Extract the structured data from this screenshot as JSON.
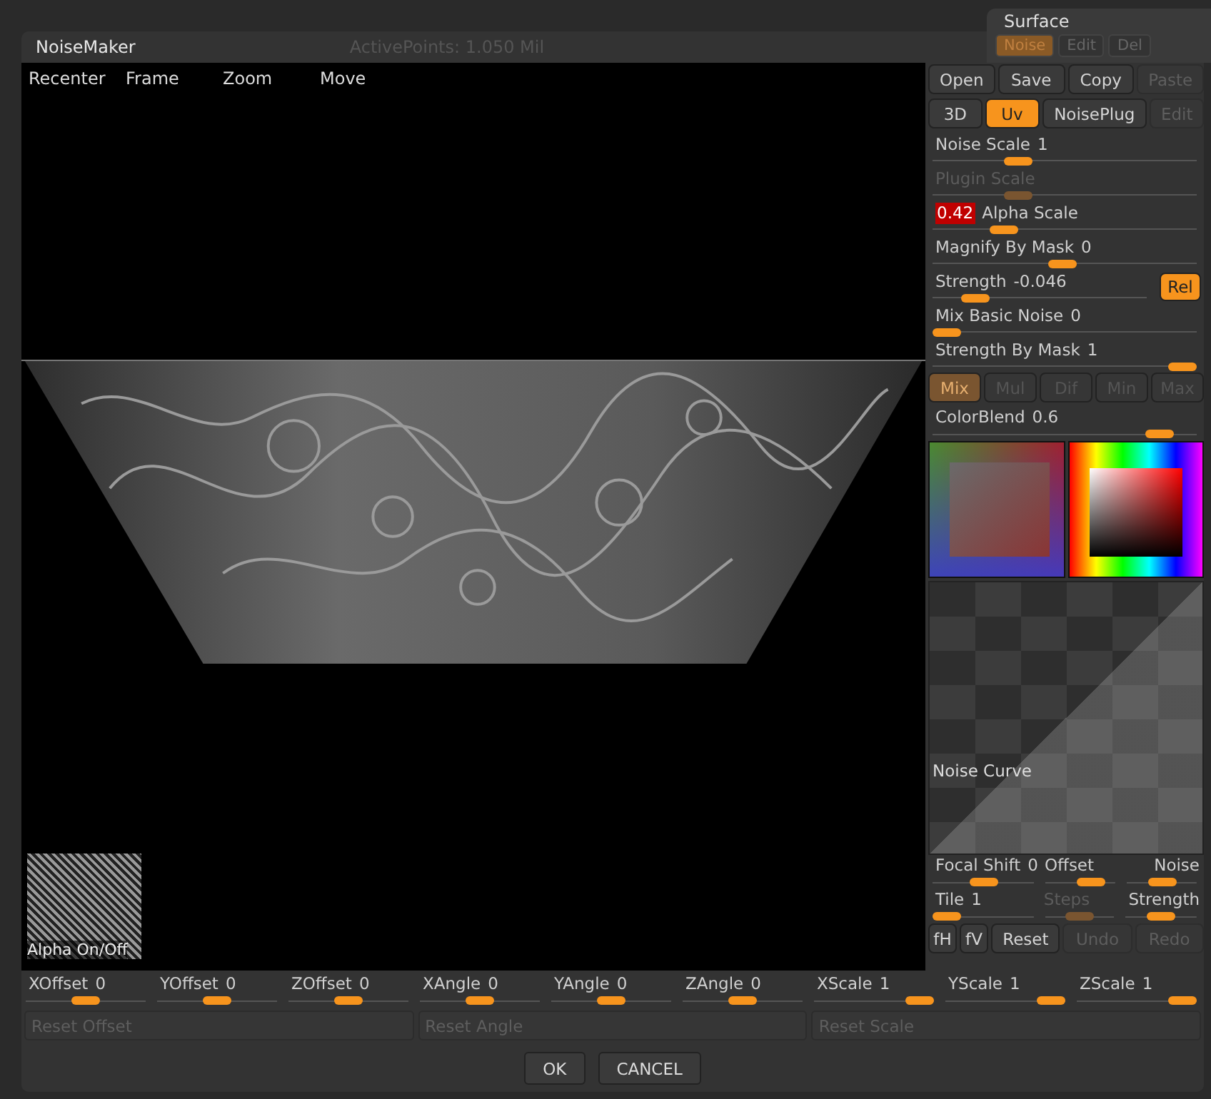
{
  "background": {
    "status": "ActivePoints: 1.050 Mil",
    "surface_panel": {
      "title": "Surface",
      "buttons": [
        {
          "label": "Noise",
          "selected": true
        },
        {
          "label": "Edit",
          "selected": false
        },
        {
          "label": "Del",
          "selected": false
        }
      ]
    }
  },
  "dialog": {
    "title": "NoiseMaker",
    "viewport_menu": [
      "Recenter",
      "Frame",
      "Zoom",
      "Move"
    ],
    "alpha_label": "Alpha On/Off",
    "file_buttons": [
      {
        "label": "Open",
        "disabled": false
      },
      {
        "label": "Save",
        "disabled": false
      },
      {
        "label": "Copy",
        "disabled": false
      },
      {
        "label": "Paste",
        "disabled": true
      }
    ],
    "mode_buttons": [
      {
        "label": "3D",
        "selected": false,
        "disabled": false
      },
      {
        "label": "Uv",
        "selected": true,
        "disabled": false
      },
      {
        "label": "NoisePlug",
        "selected": false,
        "disabled": false
      },
      {
        "label": "Edit",
        "selected": false,
        "disabled": true
      }
    ],
    "sliders": [
      {
        "kind": "plain",
        "label": "Noise Scale",
        "value": "1",
        "level": 0.3,
        "disabled": false
      },
      {
        "kind": "plain",
        "label": "Plugin Scale",
        "level": 0.3,
        "disabled": true
      },
      {
        "kind": "value-first",
        "label": "Alpha Scale",
        "value": "0.42",
        "level": 0.24,
        "disabled": false
      },
      {
        "kind": "plain",
        "label": "Magnify By Mask",
        "value": "0",
        "level": 0.49,
        "disabled": false
      },
      {
        "kind": "plain",
        "label": "Strength",
        "value": "-0.046",
        "level": 0.15,
        "disabled": false,
        "toggle": {
          "label": "Rel",
          "on": true
        }
      },
      {
        "kind": "plain",
        "label": "Mix Basic Noise",
        "value": "0",
        "level": 0,
        "disabled": false
      },
      {
        "kind": "plain",
        "label": "Strength By Mask",
        "value": "1",
        "level": 1,
        "disabled": false
      }
    ],
    "blend_modes": [
      {
        "label": "Mix",
        "selected": true
      },
      {
        "label": "Mul",
        "selected": false
      },
      {
        "label": "Dif",
        "selected": false
      },
      {
        "label": "Min",
        "selected": false
      },
      {
        "label": "Max",
        "selected": false
      }
    ],
    "color_blend": {
      "label": "ColorBlend",
      "value": "0.6",
      "level": 0.9
    },
    "noise_curve_label": "Noise Curve",
    "curve_sliders": [
      [
        {
          "label": "Focal Shift",
          "value": "0",
          "level": 0.5,
          "disabled": false
        },
        {
          "label": "Offset",
          "level": 0.75,
          "disabled": false
        },
        {
          "label": "Noise",
          "level": 0.5,
          "disabled": false
        }
      ],
      [
        {
          "label": "Tile",
          "value": "1",
          "level": 0,
          "disabled": false
        },
        {
          "label": "Steps",
          "level": 0.5,
          "disabled": true
        },
        {
          "label": "Strength",
          "level": 0.5,
          "disabled": false
        }
      ]
    ],
    "edit_buttons": [
      {
        "label": "fH",
        "disabled": false
      },
      {
        "label": "fV",
        "disabled": false
      },
      {
        "label": "Reset",
        "disabled": false
      },
      {
        "label": "Undo",
        "disabled": true
      },
      {
        "label": "Redo",
        "disabled": true
      }
    ],
    "transform_sliders": [
      {
        "label": "XOffset",
        "value": "0",
        "level": 0.5
      },
      {
        "label": "YOffset",
        "value": "0",
        "level": 0.5
      },
      {
        "label": "ZOffset",
        "value": "0",
        "level": 0.5
      },
      {
        "label": "XAngle",
        "value": "0",
        "level": 0.5
      },
      {
        "label": "YAngle",
        "value": "0",
        "level": 0.5
      },
      {
        "label": "ZAngle",
        "value": "0",
        "level": 0.5
      },
      {
        "label": "XScale",
        "value": "1",
        "level": 1
      },
      {
        "label": "YScale",
        "value": "1",
        "level": 1
      },
      {
        "label": "ZScale",
        "value": "1",
        "level": 1
      }
    ],
    "reset_buttons": [
      "Reset Offset",
      "Reset Angle",
      "Reset Scale"
    ],
    "actions": [
      "OK",
      "CANCEL"
    ]
  }
}
